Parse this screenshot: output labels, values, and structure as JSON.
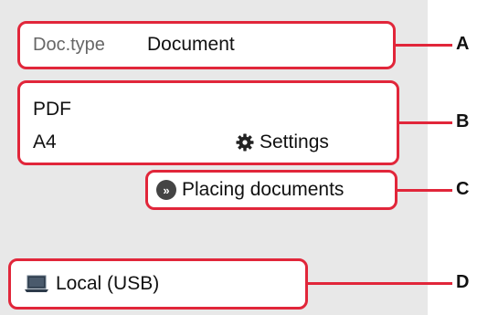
{
  "doc_type": {
    "label": "Doc.type",
    "value": "Document"
  },
  "format": {
    "file_type": "PDF",
    "paper_size": "A4",
    "settings_label": "Settings",
    "settings_icon": "gear-icon"
  },
  "placing_documents": {
    "label": "Placing documents",
    "icon": "double-chevron-right-icon"
  },
  "destination": {
    "label": "Local (USB)",
    "icon": "laptop-icon"
  },
  "callouts": [
    "A",
    "B",
    "C",
    "D"
  ],
  "colors": {
    "highlight": "#e1263a",
    "screen_bg": "#e8e8e8"
  }
}
